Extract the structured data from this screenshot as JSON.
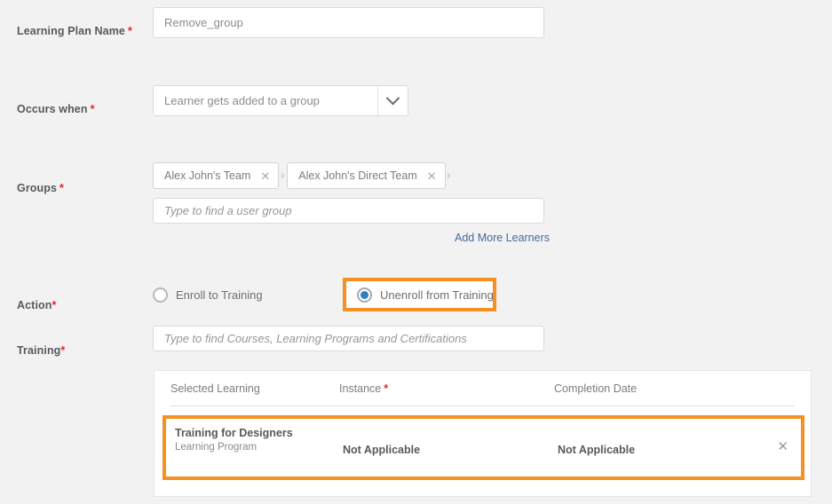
{
  "colors": {
    "page_background": "#f2f2f2",
    "highlight_orange": "#f49122",
    "required_red": "#e8232a",
    "link_blue": "#47689e",
    "radio_selected_blue": "#2f7fc1",
    "label_gray": "#58595b"
  },
  "form": {
    "learning_plan_name": {
      "label": "Learning Plan Name",
      "required_marker": "*",
      "value": "Remove_group",
      "placeholder": "Remove_group"
    },
    "occurs_when": {
      "label": "Occurs when",
      "required_marker": "*",
      "selected_option": "Learner gets added to a group",
      "dropdown_icon": "chevron-down-icon"
    },
    "groups": {
      "label": "Groups",
      "required_marker": "*",
      "chips": [
        {
          "label": "Alex John's Team",
          "remove_icon": "close-icon"
        },
        {
          "label": "Alex John's Direct Team",
          "remove_icon": "close-icon"
        }
      ],
      "search_placeholder": "Type to find a user group",
      "add_more_link": "Add More Learners"
    },
    "action": {
      "label": "Action",
      "required_marker": "*",
      "options": [
        {
          "label": "Enroll to Training",
          "selected": false,
          "highlighted": false
        },
        {
          "label": "Unenroll from Training",
          "selected": true,
          "highlighted": true
        }
      ]
    },
    "training": {
      "label": "Training",
      "required_marker": "*",
      "search_placeholder": "Type to find Courses, Learning Programs and Certifications"
    }
  },
  "training_table": {
    "columns": [
      {
        "label": "Selected Learning",
        "required_marker": ""
      },
      {
        "label": "Instance",
        "required_marker": "*"
      },
      {
        "label": "Completion Date",
        "required_marker": ""
      }
    ],
    "rows": [
      {
        "title": "Training for Designers",
        "subtitle": "Learning Program",
        "instance": "Not Applicable",
        "completion_date": "Not Applicable",
        "remove_icon": "close-icon",
        "highlighted": true
      }
    ]
  }
}
